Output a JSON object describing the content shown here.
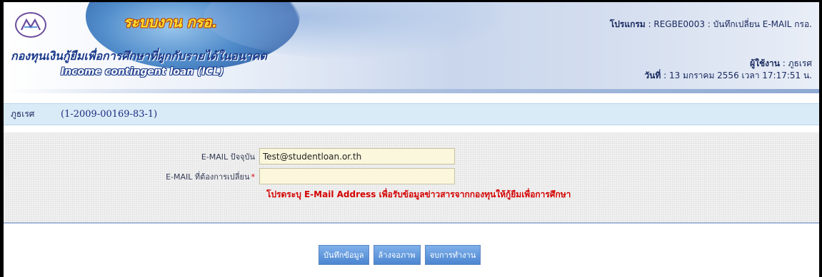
{
  "header": {
    "app_name": "ระบบงาน กรอ.",
    "fund_name_th": "กองทุนเงินกู้ยืมเพื่อการศึกษาที่ผูกกับรายได้ในอนาคต",
    "fund_name_en": "Income contingent loan (ICL)",
    "logo_icon": "icl-fund-logo",
    "program_label": "โปรแกรม",
    "program_value": ": REGBE0003  : บันทึกเปลี่ยน E-MAIL กรอ.",
    "user_label": "ผู้ใช้งาน",
    "user_value": ": ภูธเรศ",
    "date_label": "วันที่",
    "date_value": ": 13 มกราคม 2556 เวลา 17:17:51 น."
  },
  "student": {
    "name": "ภูธเรศ",
    "id": "(1-2009-00169-83-1)"
  },
  "form": {
    "current_email_label": "E-MAIL ปัจจุบัน",
    "current_email_value": "Test@studentloan.or.th",
    "new_email_label": "E-MAIL ที่ต้องการเปลี่ยน",
    "required_mark": "*",
    "new_email_value": "",
    "hint": "โปรดระบุ E-Mail Address เพื่อรับข้อมูลข่าวสารจากกองทุนให้กู้ยืมเพื่อการศึกษา"
  },
  "buttons": {
    "save": "บันทึกข้อมูล",
    "clear": "ล้างจอภาพ",
    "finish": "จบการทำงาน"
  },
  "colors": {
    "accent_blue": "#4c86d1",
    "hint_red": "#d40000",
    "student_bar": "#d9ebf7"
  }
}
